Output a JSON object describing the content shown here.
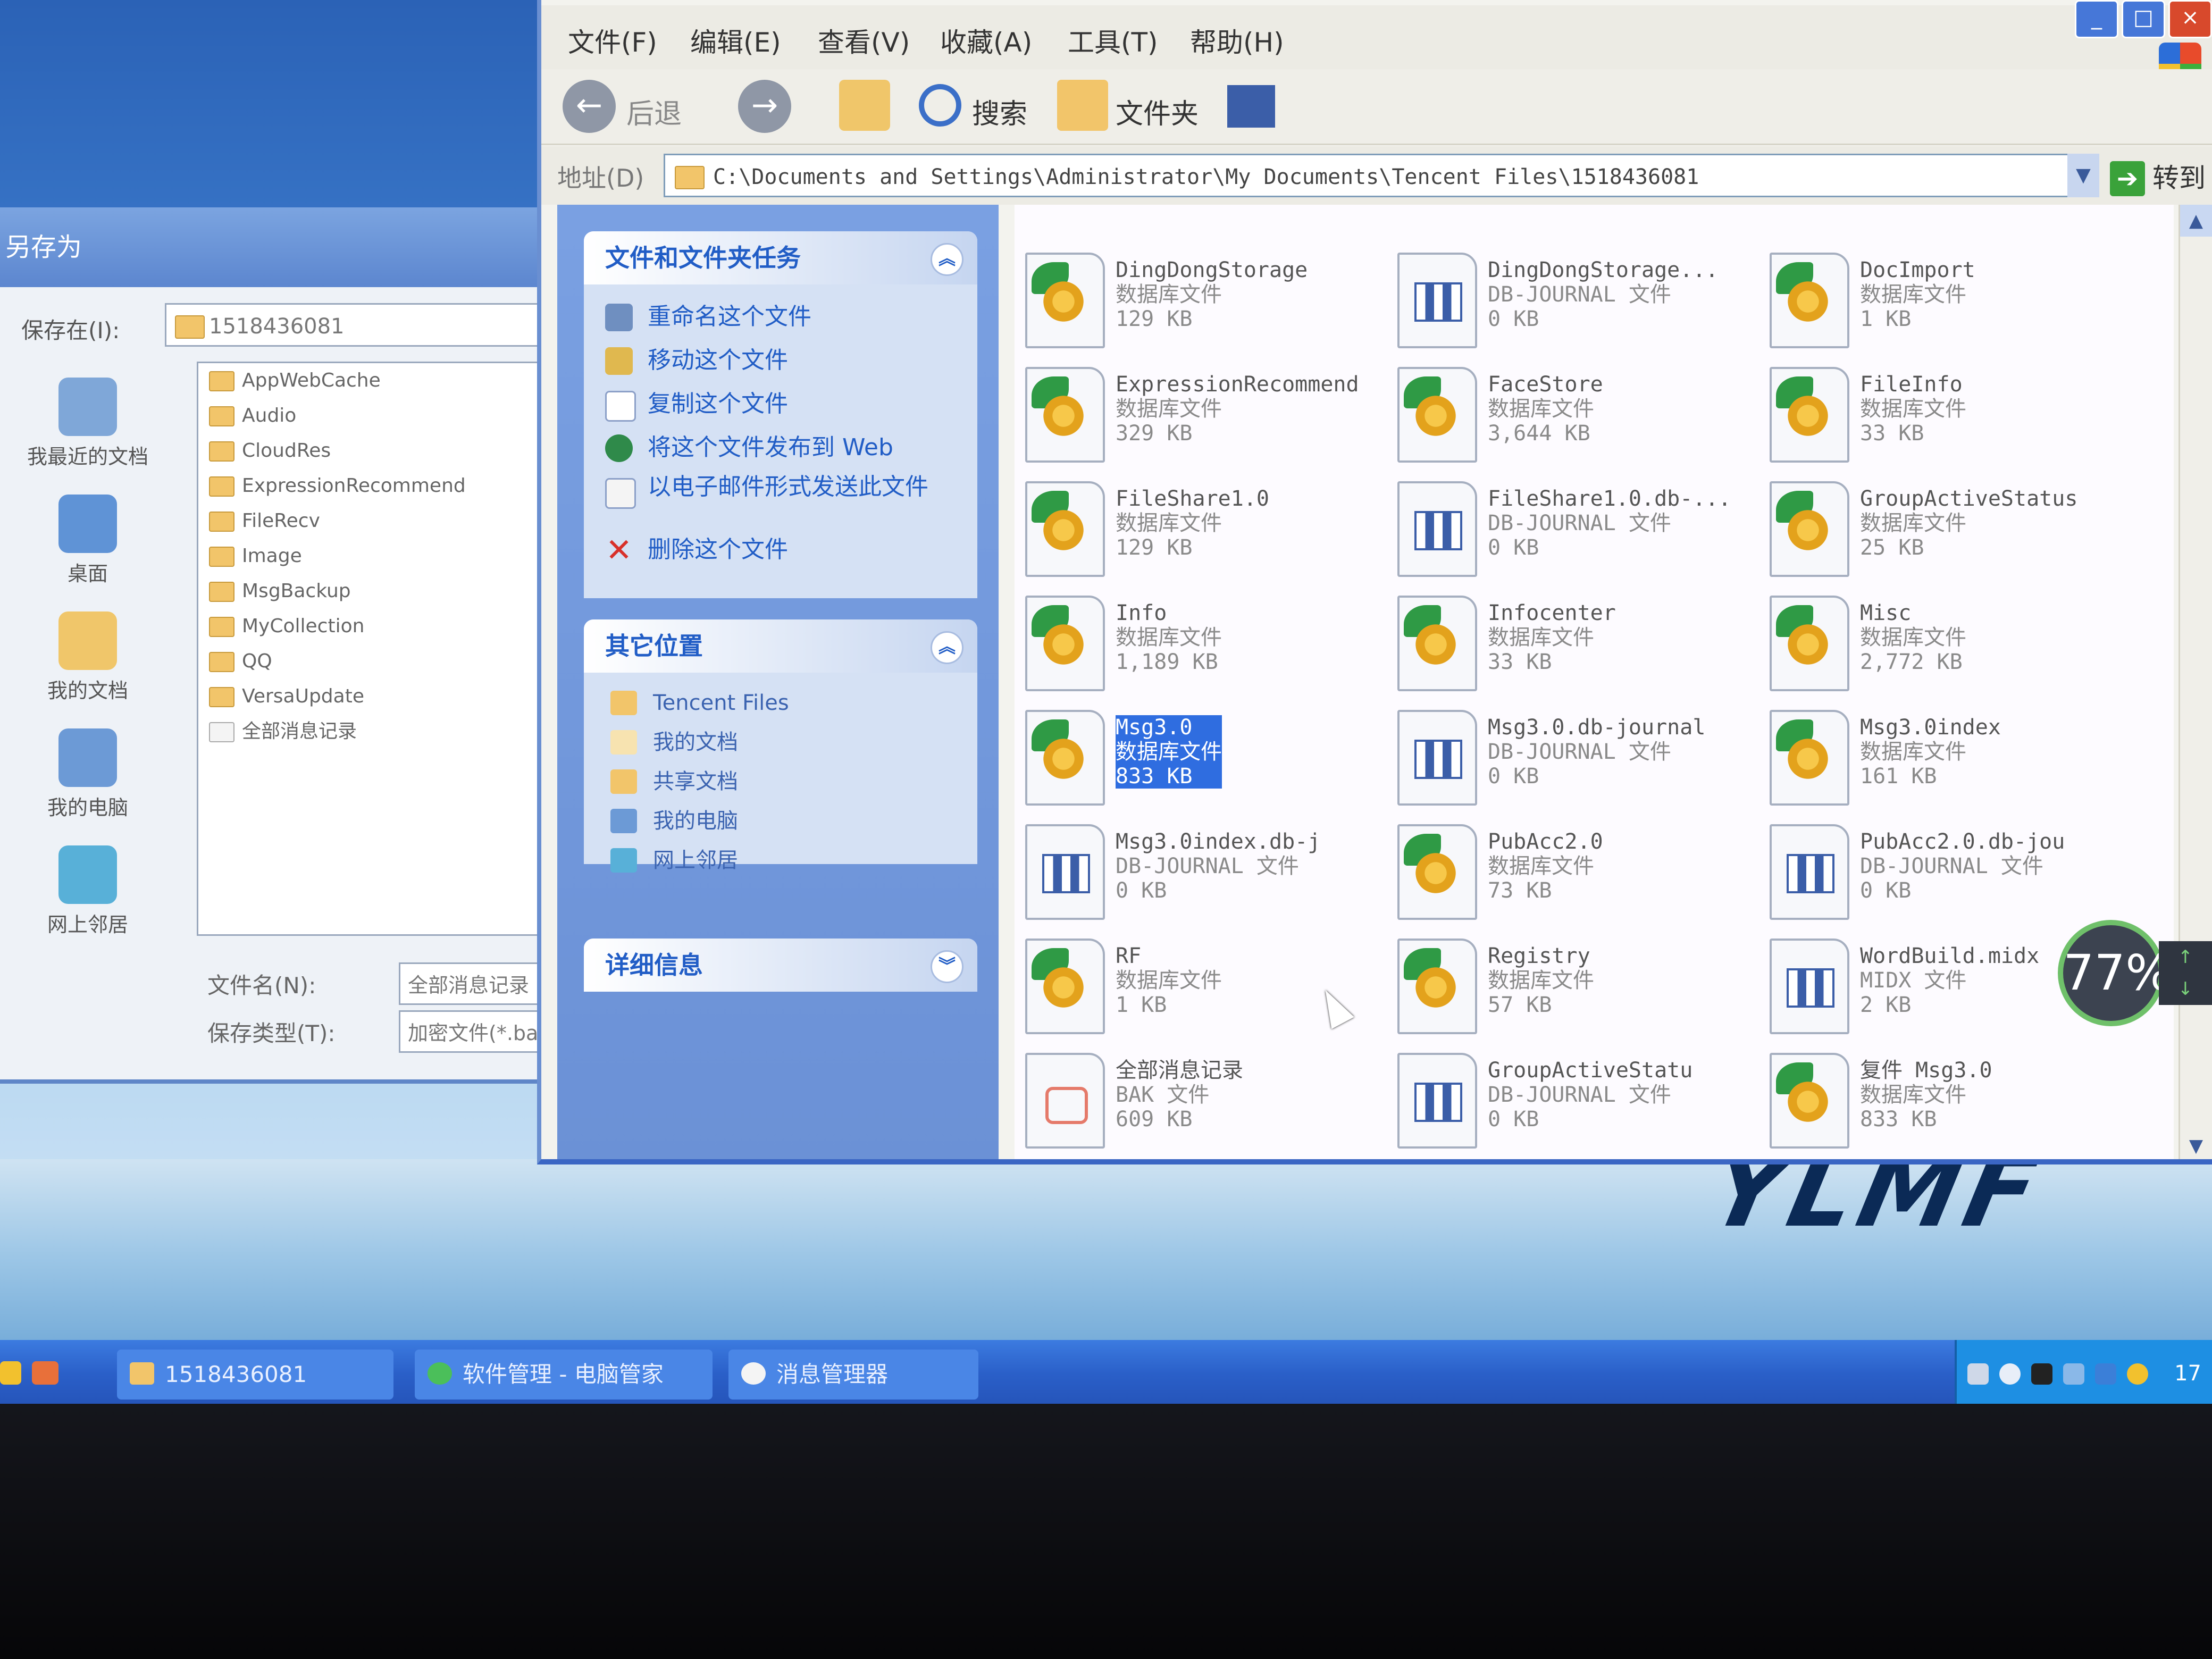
{
  "explorer": {
    "menu": [
      "文件(F)",
      "编辑(E)",
      "查看(V)",
      "收藏(A)",
      "工具(T)",
      "帮助(H)"
    ],
    "toolbar": {
      "back_label": "后退",
      "search_label": "搜索",
      "folders_label": "文件夹"
    },
    "address": {
      "label": "地址(D)",
      "value": "C:\\Documents and Settings\\Administrator\\My Documents\\Tencent Files\\1518436081",
      "go_label": "转到"
    },
    "task_pane": {
      "file_tasks": {
        "title": "文件和文件夹任务",
        "items": [
          "重命名这个文件",
          "移动这个文件",
          "复制这个文件",
          "将这个文件发布到 Web",
          "以电子邮件形式发送此文件",
          "删除这个文件"
        ]
      },
      "other_places": {
        "title": "其它位置",
        "items": [
          "Tencent Files",
          "我的文档",
          "共享文档",
          "我的电脑",
          "网上邻居"
        ]
      },
      "details": {
        "title": "详细信息"
      }
    },
    "files": [
      {
        "name": "DingDongStorage",
        "type": "数据库文件",
        "size": "129 KB",
        "icon": "database-icon"
      },
      {
        "name": "DingDongStorage...",
        "type": "DB-JOURNAL 文件",
        "size": "0 KB",
        "icon": "journal-icon"
      },
      {
        "name": "DocImport",
        "type": "数据库文件",
        "size": "1 KB",
        "icon": "database-icon"
      },
      {
        "name": "ExpressionRecommend",
        "type": "数据库文件",
        "size": "329 KB",
        "icon": "database-icon"
      },
      {
        "name": "FaceStore",
        "type": "数据库文件",
        "size": "3,644 KB",
        "icon": "database-icon"
      },
      {
        "name": "FileInfo",
        "type": "数据库文件",
        "size": "33 KB",
        "icon": "database-icon"
      },
      {
        "name": "FileShare1.0",
        "type": "数据库文件",
        "size": "129 KB",
        "icon": "database-icon"
      },
      {
        "name": "FileShare1.0.db-...",
        "type": "DB-JOURNAL 文件",
        "size": "0 KB",
        "icon": "journal-icon"
      },
      {
        "name": "GroupActiveStatus",
        "type": "数据库文件",
        "size": "25 KB",
        "icon": "database-icon"
      },
      {
        "name": "Info",
        "type": "数据库文件",
        "size": "1,189 KB",
        "icon": "database-icon"
      },
      {
        "name": "Infocenter",
        "type": "数据库文件",
        "size": "33 KB",
        "icon": "database-icon"
      },
      {
        "name": "Misc",
        "type": "数据库文件",
        "size": "2,772 KB",
        "icon": "database-icon"
      },
      {
        "name": "Msg3.0",
        "type": "数据库文件",
        "size": "833 KB",
        "icon": "database-icon",
        "selected": true
      },
      {
        "name": "Msg3.0.db-journal",
        "type": "DB-JOURNAL 文件",
        "size": "0 KB",
        "icon": "journal-icon"
      },
      {
        "name": "Msg3.0index",
        "type": "数据库文件",
        "size": "161 KB",
        "icon": "database-icon"
      },
      {
        "name": "Msg3.0index.db-j",
        "type": "DB-JOURNAL 文件",
        "size": "0 KB",
        "icon": "journal-icon"
      },
      {
        "name": "PubAcc2.0",
        "type": "数据库文件",
        "size": "73 KB",
        "icon": "database-icon"
      },
      {
        "name": "PubAcc2.0.db-jou",
        "type": "DB-JOURNAL 文件",
        "size": "0 KB",
        "icon": "journal-icon"
      },
      {
        "name": "RF",
        "type": "数据库文件",
        "size": "1 KB",
        "icon": "database-icon"
      },
      {
        "name": "Registry",
        "type": "数据库文件",
        "size": "57 KB",
        "icon": "database-icon"
      },
      {
        "name": "WordBuild.midx",
        "type": "MIDX 文件",
        "size": "2 KB",
        "icon": "journal-icon"
      },
      {
        "name": "全部消息记录",
        "type": "BAK 文件",
        "size": "609 KB",
        "icon": "bak-file-icon"
      },
      {
        "name": "GroupActiveStatu",
        "type": "DB-JOURNAL 文件",
        "size": "0 KB",
        "icon": "journal-icon"
      },
      {
        "name": "复件 Msg3.0",
        "type": "数据库文件",
        "size": "833 KB",
        "icon": "database-icon"
      }
    ]
  },
  "save_dialog": {
    "title": "另存为",
    "save_in_label": "保存在(I):",
    "save_in_value": "1518436081",
    "places": [
      "我最近的文档",
      "桌面",
      "我的文档",
      "我的电脑",
      "网上邻居"
    ],
    "folders": [
      "AppWebCache",
      "Audio",
      "CloudRes",
      "ExpressionRecommend",
      "FileRecv",
      "Image",
      "MsgBackup",
      "MyCollection",
      "QQ",
      "VersaUpdate",
      "全部消息记录"
    ],
    "filename_label": "文件名(N):",
    "filename_value": "全部消息记录",
    "filetype_label": "保存类型(T):",
    "filetype_value": "加密文件(*.bak)"
  },
  "taskbar": {
    "buttons": [
      "1518436081",
      "软件管理 - 电脑管家",
      "消息管理器"
    ],
    "clock": "17"
  },
  "speed_badge": "77%",
  "brand": "YLMF"
}
